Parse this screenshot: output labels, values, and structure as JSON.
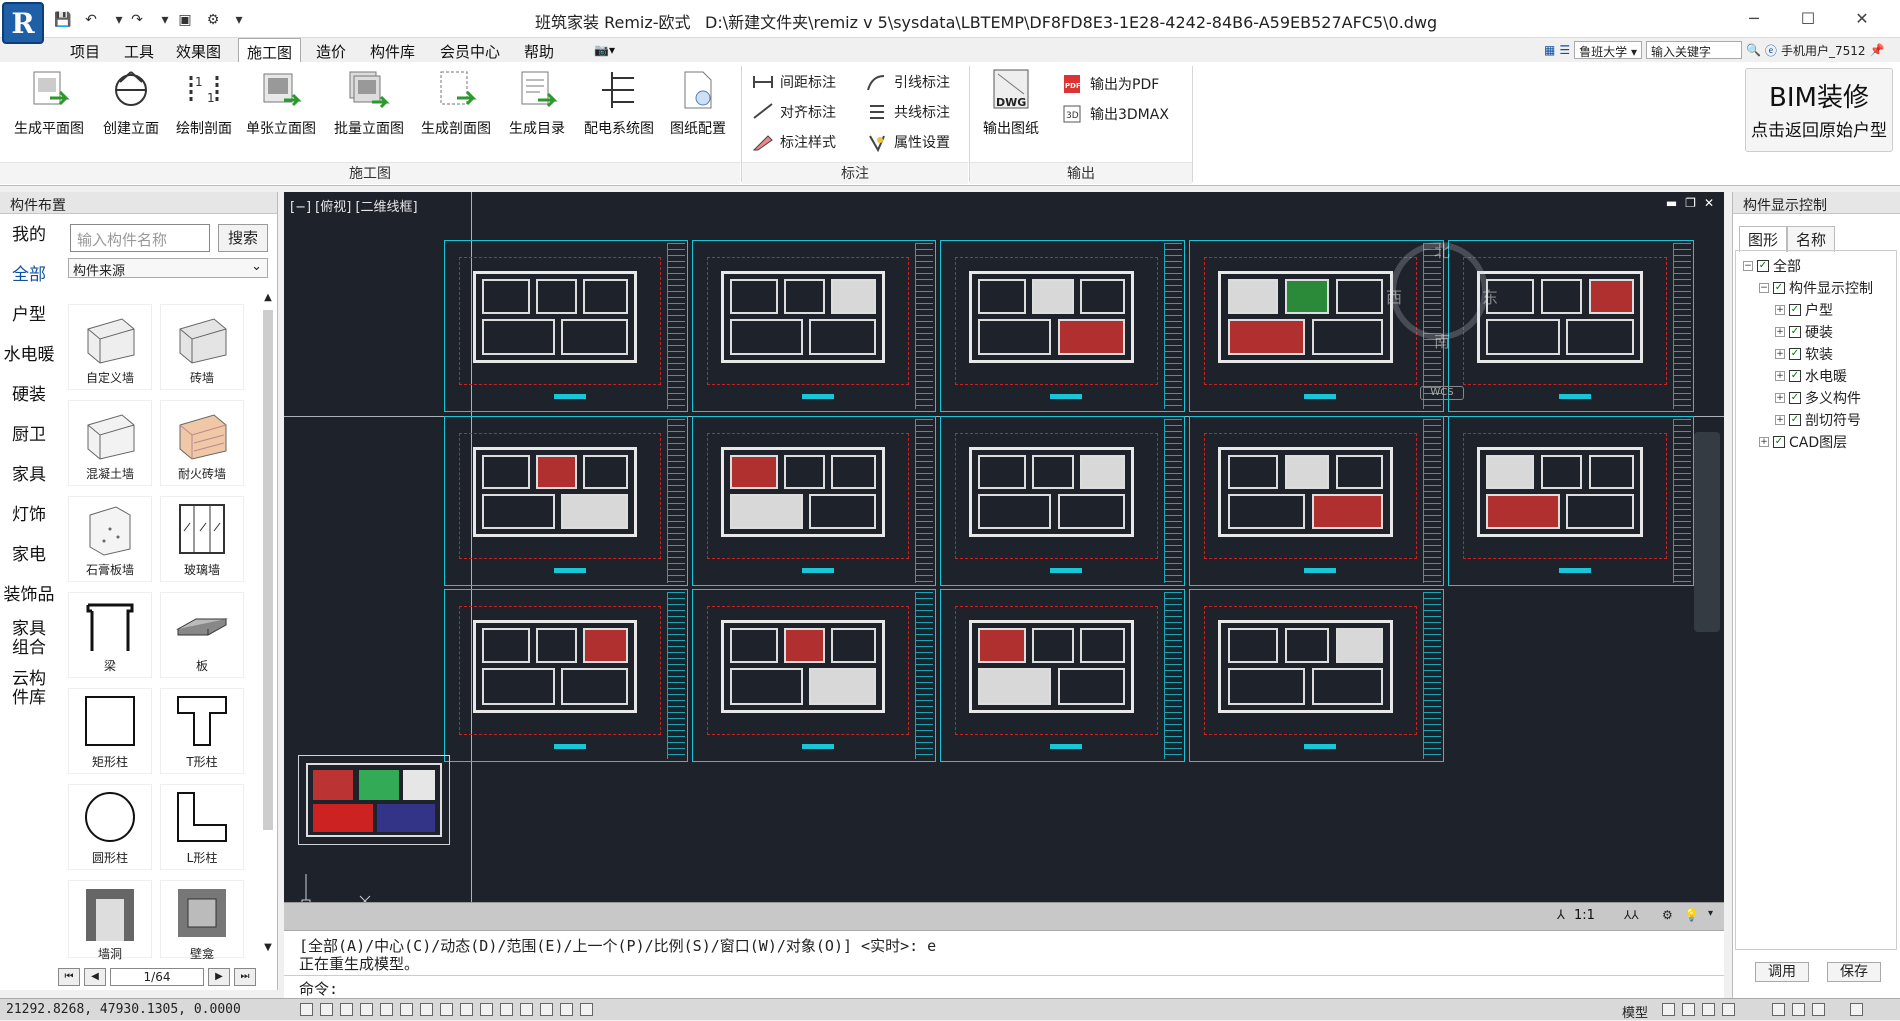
{
  "window": {
    "app_title": "班筑家装 Remiz-欧式",
    "file_path": "D:\\新建文件夹\\remiz v 5\\sysdata\\LBTEMP\\DF8FD8E3-1E28-4242-84B6-A59EB527AFC5\\0.dwg",
    "logo_letter": "R"
  },
  "menu": {
    "items": [
      "项目",
      "工具",
      "效果图",
      "施工图",
      "造价",
      "构件库",
      "会员中心",
      "帮助"
    ],
    "active": "施工图"
  },
  "topright": {
    "school": "鲁班大学",
    "search_placeholder": "输入关键字",
    "user": "手机用户_7512"
  },
  "ribbon": {
    "construction_group": {
      "label": "施工图",
      "buttons": [
        "生成平面图",
        "创建立面",
        "绘制剖面",
        "单张立面图",
        "批量立面图",
        "生成剖面图",
        "生成目录",
        "配电系统图",
        "图纸配置"
      ]
    },
    "annotation_group": {
      "label": "标注",
      "items": [
        "间距标注",
        "对齐标注",
        "标注样式",
        "引线标注",
        "共线标注",
        "属性设置"
      ]
    },
    "output_group": {
      "label": "输出",
      "export_drawing": "输出图纸",
      "dwg_label": "DWG",
      "pdf_label": "PDF",
      "export_pdf": "输出为PDF",
      "export_3dmax": "输出3DMAX"
    },
    "bim": {
      "title": "BIM装修",
      "subtitle": "点击返回原始户型"
    }
  },
  "left_panel": {
    "title": "构件布置",
    "categories": [
      "我的",
      "全部",
      "户型",
      "水电暖",
      "硬装",
      "厨卫",
      "家具",
      "灯饰",
      "家电",
      "装饰品",
      "家具\n组合",
      "云构\n件库"
    ],
    "selected_category": "全部",
    "search_placeholder": "输入构件名称",
    "search_button": "搜索",
    "source_select": "构件来源",
    "parts": [
      "自定义墙",
      "砖墙",
      "混凝土墙",
      "耐火砖墙",
      "石膏板墙",
      "玻璃墙",
      "梁",
      "板",
      "矩形柱",
      "T形柱",
      "圆形柱",
      "L形柱",
      "墙洞",
      "壁龛"
    ],
    "pager": "1/64"
  },
  "canvas": {
    "title": "[−] [俯视] [二维线框]",
    "scale": "1:1",
    "compass": {
      "north": "北",
      "east": "东",
      "south": "南",
      "west": "西"
    },
    "wcs": "WCS"
  },
  "command": {
    "line1": "[全部(A)/中心(C)/动态(D)/范围(E)/上一个(P)/比例(S)/窗口(W)/对象(O)] <实时>: e",
    "line2": "正在重生成模型。",
    "prompt": "命令:"
  },
  "right_panel": {
    "title": "构件显示控制",
    "tabs": [
      "图形",
      "名称"
    ],
    "tree": {
      "root": "全部",
      "group": "构件显示控制",
      "children": [
        "户型",
        "硬装",
        "软装",
        "水电暖",
        "多义构件",
        "剖切符号"
      ],
      "cad_layers": "CAD图层"
    },
    "apply_button": "调用",
    "save_button": "保存"
  },
  "statusbar": {
    "coords": "21292.8268,   47930.1305,  0.0000",
    "model": "模型"
  },
  "colors": {
    "canvas_bg": "#1e232b",
    "sheet_border": "#19c6d8",
    "frame_red": "#cc2222",
    "accent": "#1050a0"
  }
}
